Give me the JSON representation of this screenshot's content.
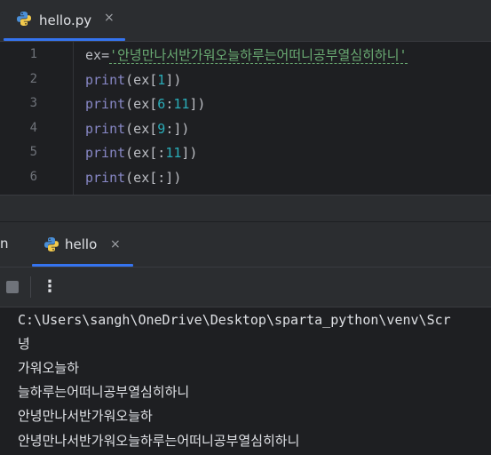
{
  "editor_tab": {
    "label": "hello.py",
    "close": "×",
    "icon": "python-icon"
  },
  "editor": {
    "line_numbers": [
      "1",
      "2",
      "3",
      "4",
      "5",
      "6"
    ],
    "lines": [
      [
        {
          "t": "ex",
          "c": "var"
        },
        {
          "t": "=",
          "c": "var"
        },
        {
          "t": "'안녕만나서반가워오늘하루는어떠니공부열심히하니'",
          "c": "str"
        }
      ],
      [
        {
          "t": "print",
          "c": "kw-print"
        },
        {
          "t": "(ex[",
          "c": "var"
        },
        {
          "t": "1",
          "c": "num"
        },
        {
          "t": "])",
          "c": "var"
        }
      ],
      [
        {
          "t": "print",
          "c": "kw-print"
        },
        {
          "t": "(ex[",
          "c": "var"
        },
        {
          "t": "6",
          "c": "num"
        },
        {
          "t": ":",
          "c": "var"
        },
        {
          "t": "11",
          "c": "num"
        },
        {
          "t": "])",
          "c": "var"
        }
      ],
      [
        {
          "t": "print",
          "c": "kw-print"
        },
        {
          "t": "(ex[",
          "c": "var"
        },
        {
          "t": "9",
          "c": "num"
        },
        {
          "t": ":])",
          "c": "var"
        }
      ],
      [
        {
          "t": "print",
          "c": "kw-print"
        },
        {
          "t": "(ex[:",
          "c": "var"
        },
        {
          "t": "11",
          "c": "num"
        },
        {
          "t": "])",
          "c": "var"
        }
      ],
      [
        {
          "t": "print",
          "c": "kw-print"
        },
        {
          "t": "(ex[:])",
          "c": "var"
        }
      ]
    ]
  },
  "run_window": {
    "label": "n",
    "tab": {
      "label": "hello",
      "close": "×",
      "icon": "python-icon"
    },
    "toolbar": {
      "stop_icon": "stop-icon",
      "more": "⋮"
    }
  },
  "console": {
    "command": "C:\\Users\\sangh\\OneDrive\\Desktop\\sparta_python\\venv\\Scr",
    "output": [
      "녕",
      "가워오늘하",
      "늘하루는어떠니공부열심히하니",
      "안녕만나서반가워오늘하",
      "안녕만나서반가워오늘하루는어떠니공부열심히하니"
    ]
  },
  "colors": {
    "accent": "#3574f0",
    "string": "#6aab73",
    "number": "#2aacb8",
    "builtin": "#8888c6"
  }
}
